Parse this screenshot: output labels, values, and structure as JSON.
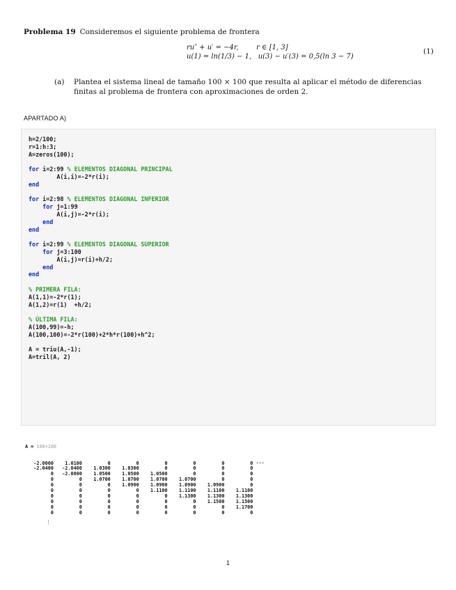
{
  "problem": {
    "label": "Problema 19",
    "statement": "Consideremos el siguiente problema de frontera"
  },
  "equations": {
    "line1": "ru″ + u′ = −4r,        r ∈ [1, 3]",
    "line2": "u(1) = ln(1/3) − 1,   u(3) − u′(3) = 0,5(ln 3 − 7)",
    "number": "(1)"
  },
  "part_a": {
    "label": "(a)",
    "text": "Plantea el sistema lineal de tamaño 100 × 100 que resulta al aplicar el método de diferencias finitas al problema de frontera con aproximaciones de orden 2."
  },
  "section_heading": "APARTADO A)",
  "code": {
    "lines": [
      {
        "text": "h=2/100;"
      },
      {
        "text": "r=1:h:3;"
      },
      {
        "text": "A=zeros(100);"
      },
      {
        "text": ""
      },
      {
        "kw": "for",
        "text": " i=2:99 ",
        "comment": "% ELEMENTOS DIAGONAL PRINCIPAL"
      },
      {
        "text": "        A(i,i)=-2*r(i);"
      },
      {
        "kw": "end"
      },
      {
        "text": ""
      },
      {
        "kw": "for",
        "text": " i=2:98 ",
        "comment": "% ELEMENTOS DIAGONAL INFERIOR"
      },
      {
        "pre": "    ",
        "kw": "for",
        "text": " j=1:99"
      },
      {
        "text": "        A(i,j)=-2*r(i);"
      },
      {
        "pre": "    ",
        "kw": "end"
      },
      {
        "kw": "end"
      },
      {
        "text": ""
      },
      {
        "kw": "for",
        "text": " i=2:99 ",
        "comment": "% ELEMENTOS DIAGONAL SUPERIOR"
      },
      {
        "pre": "    ",
        "kw": "for",
        "text": " j=3:100"
      },
      {
        "text": "        A(i,j)=r(i)+h/2;"
      },
      {
        "pre": "    ",
        "kw": "end"
      },
      {
        "kw": "end"
      },
      {
        "text": ""
      },
      {
        "comment": "% PRIMERA FILA:"
      },
      {
        "text": "A(1,1)=-2*r(1);"
      },
      {
        "text": "A(1,2)=r(1)  +h/2;"
      },
      {
        "text": ""
      },
      {
        "comment": "% ÚLTIMA FILA:"
      },
      {
        "text": "A(100,99)=-h;"
      },
      {
        "text": "A(100,100)=-2*r(100)+2*h*r(100)+h^2;"
      },
      {
        "text": ""
      },
      {
        "text": "A = triu(A,-1);"
      },
      {
        "text": "A=tril(A, 2)"
      }
    ]
  },
  "output": {
    "var": "A = ",
    "size": "100×100",
    "rows": [
      "   -2.0000    1.0100         0         0         0         0         0         0 ···",
      "   -2.0400   -2.0400    1.0300    1.0300         0         0         0         0",
      "         0   -2.0800    1.0500    1.0500    1.0500         0         0         0",
      "         0         0    1.0700    1.0700    1.0700    1.0700         0         0",
      "         0         0         0    1.0900    1.0900    1.0900    1.0900         0",
      "         0         0         0         0    1.1100    1.1100    1.1100    1.1100",
      "         0         0         0         0         0    1.1300    1.1300    1.1300",
      "         0         0         0         0         0         0    1.1500    1.1500",
      "         0         0         0         0         0         0         0    1.1700",
      "         0         0         0         0         0         0         0         0"
    ],
    "ellipsis": "⋮"
  },
  "page_number": "1"
}
